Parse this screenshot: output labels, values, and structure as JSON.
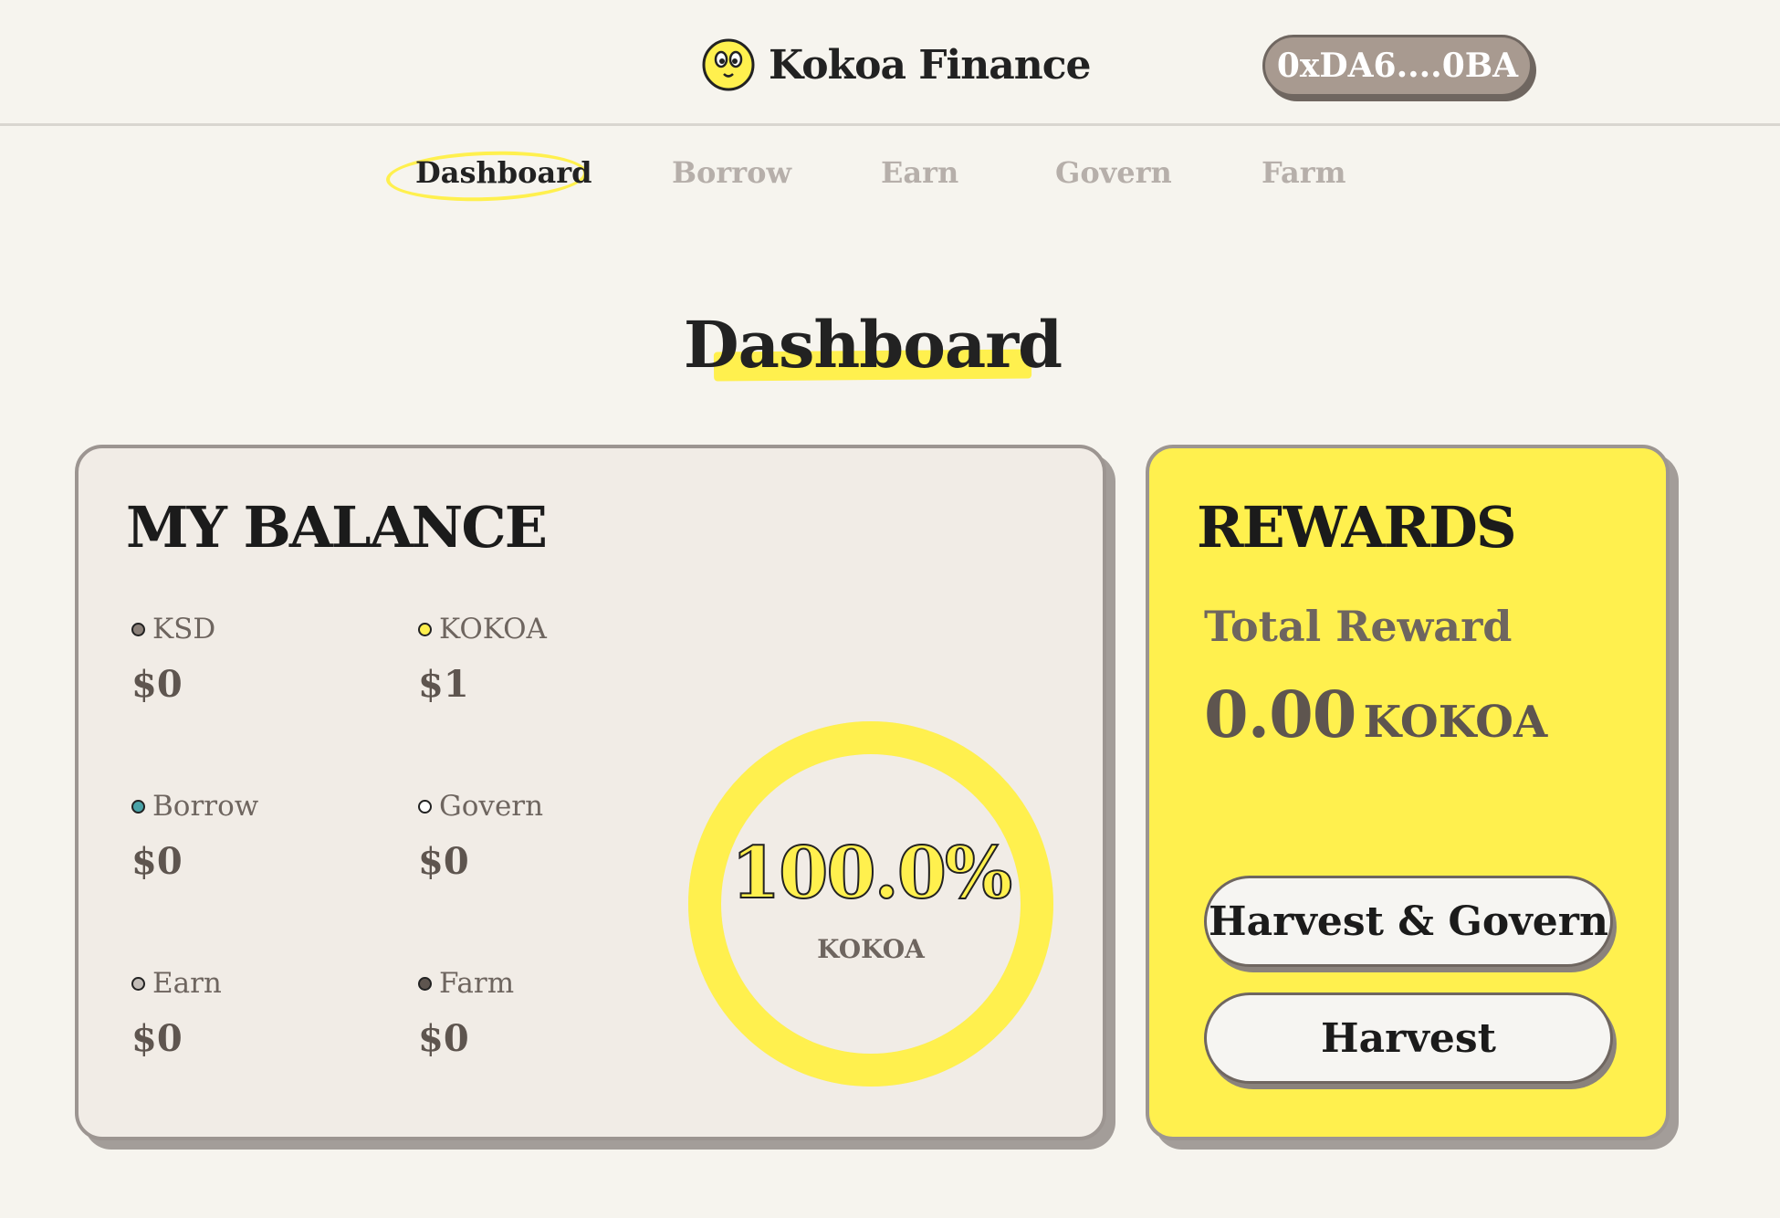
{
  "header": {
    "app_name": "Kokoa Finance",
    "logo_icon": "smiley-face-icon",
    "wallet_address": "0xDA6....0BA"
  },
  "nav": {
    "items": [
      {
        "label": "Dashboard",
        "active": true
      },
      {
        "label": "Borrow",
        "active": false
      },
      {
        "label": "Earn",
        "active": false
      },
      {
        "label": "Govern",
        "active": false
      },
      {
        "label": "Farm",
        "active": false
      }
    ]
  },
  "page": {
    "title": "Dashboard"
  },
  "balance": {
    "title": "MY BALANCE",
    "items": [
      {
        "label": "KSD",
        "value": "$0",
        "color": "#8a7f78"
      },
      {
        "label": "KOKOA",
        "value": "$1",
        "color": "#fff04e"
      },
      {
        "label": "Borrow",
        "value": "$0",
        "color": "#4aa3a8"
      },
      {
        "label": "Govern",
        "value": "$0",
        "color": "#ffffff"
      },
      {
        "label": "Earn",
        "value": "$0",
        "color": "#c3bdb8"
      },
      {
        "label": "Farm",
        "value": "$0",
        "color": "#5e554f"
      }
    ],
    "donut": {
      "percent_text": "100.0%",
      "label": "KOKOA",
      "fraction": 1.0,
      "color": "#fff04e"
    }
  },
  "rewards": {
    "title": "REWARDS",
    "total_label": "Total Reward",
    "amount": "0.00",
    "unit": "KOKOA",
    "harvest_govern_label": "Harvest & Govern",
    "harvest_label": "Harvest"
  },
  "colors": {
    "accent": "#fff04e",
    "background": "#f6f4ee",
    "card": "#f1ece6",
    "wallet": "#a89a90"
  }
}
